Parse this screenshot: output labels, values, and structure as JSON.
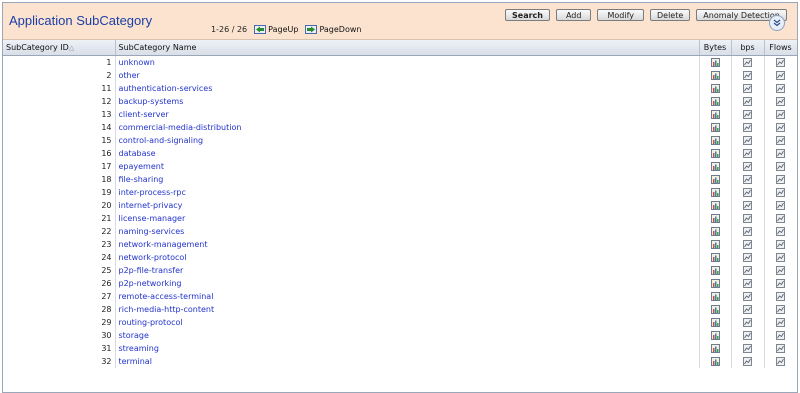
{
  "header": {
    "title": "Application SubCategory",
    "pager_count": "1-26 / 26",
    "page_up": "PageUp",
    "page_down": "PageDown"
  },
  "toolbar": {
    "search": "Search",
    "add": "Add",
    "modify": "Modify",
    "delete": "Delete",
    "anomaly": "Anomaly Detection"
  },
  "columns": {
    "id": "SubCategory ID",
    "name": "SubCategory Name",
    "bytes": "Bytes",
    "bps": "bps",
    "flows": "Flows"
  },
  "rows": [
    {
      "id": "1",
      "name": "unknown"
    },
    {
      "id": "2",
      "name": "other"
    },
    {
      "id": "11",
      "name": "authentication-services"
    },
    {
      "id": "12",
      "name": "backup-systems"
    },
    {
      "id": "13",
      "name": "client-server"
    },
    {
      "id": "14",
      "name": "commercial-media-distribution"
    },
    {
      "id": "15",
      "name": "control-and-signaling"
    },
    {
      "id": "16",
      "name": "database"
    },
    {
      "id": "17",
      "name": "epayement"
    },
    {
      "id": "18",
      "name": "file-sharing"
    },
    {
      "id": "19",
      "name": "inter-process-rpc"
    },
    {
      "id": "20",
      "name": "internet-privacy"
    },
    {
      "id": "21",
      "name": "license-manager"
    },
    {
      "id": "22",
      "name": "naming-services"
    },
    {
      "id": "23",
      "name": "network-management"
    },
    {
      "id": "24",
      "name": "network-protocol"
    },
    {
      "id": "25",
      "name": "p2p-file-transfer"
    },
    {
      "id": "26",
      "name": "p2p-networking"
    },
    {
      "id": "27",
      "name": "remote-access-terminal"
    },
    {
      "id": "28",
      "name": "rich-media-http-content"
    },
    {
      "id": "29",
      "name": "routing-protocol"
    },
    {
      "id": "30",
      "name": "storage"
    },
    {
      "id": "31",
      "name": "streaming"
    },
    {
      "id": "32",
      "name": "terminal"
    }
  ],
  "colors": {
    "header_bg": "#fbe3d0",
    "title": "#1a3fa7",
    "link": "#2233cc"
  }
}
